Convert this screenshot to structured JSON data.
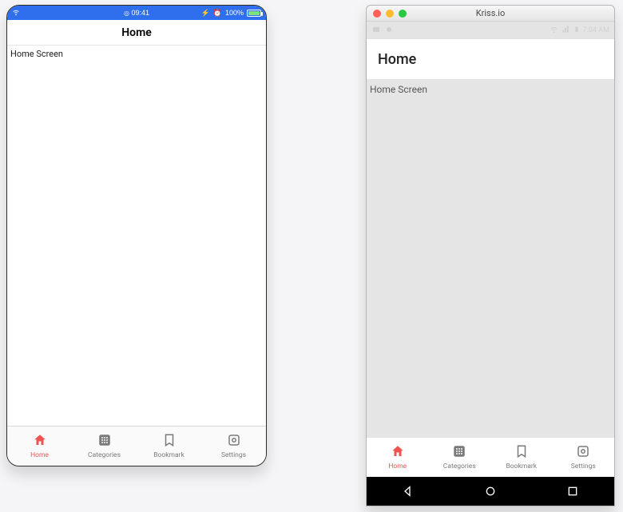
{
  "ios": {
    "status": {
      "time": "09:41",
      "battery_pct": "100%"
    },
    "header_title": "Home",
    "screen_text": "Home Screen"
  },
  "android": {
    "window_title": "Kriss.io",
    "status": {
      "time": "7:04 AM"
    },
    "header_title": "Home",
    "screen_text": "Home Screen"
  },
  "tabs": {
    "home": "Home",
    "categories": "Categories",
    "bookmark": "Bookmark",
    "settings": "Settings"
  },
  "colors": {
    "accent": "#ef5350"
  }
}
